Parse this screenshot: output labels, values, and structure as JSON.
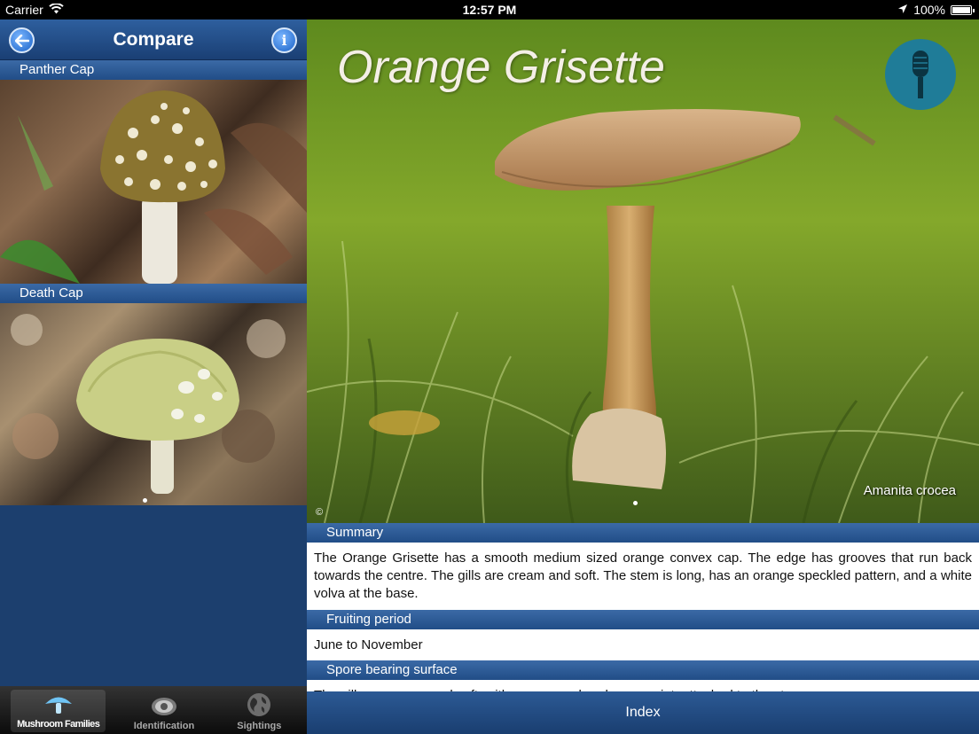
{
  "status": {
    "carrier": "Carrier",
    "time": "12:57 PM",
    "battery": "100%"
  },
  "nav": {
    "title": "Compare"
  },
  "compare": {
    "items": [
      {
        "label": "Panther Cap"
      },
      {
        "label": "Death Cap"
      }
    ]
  },
  "tabs": [
    {
      "label": "Mushroom Families",
      "icon": "mushroom-icon"
    },
    {
      "label": "Identification",
      "icon": "eye-icon"
    },
    {
      "label": "Sightings",
      "icon": "globe-icon"
    }
  ],
  "species": {
    "common_name": "Orange Grisette",
    "latin_name": "Amanita crocea",
    "copyright": "©"
  },
  "sections": {
    "summary_title": "Summary",
    "summary_text": "The Orange Grisette has a smooth medium sized orange convex cap. The edge has grooves that run back towards the centre. The gills are cream and soft. The stem is long, has an orange speckled pattern, and a white volva at the base.",
    "fruiting_title": "Fruiting period",
    "fruiting_text": "June to November",
    "spore_title": "Spore bearing surface",
    "spore_text": "The gills are cream and soft, with a cream colored spore print, attached to the stem."
  },
  "index_label": "Index",
  "colors": {
    "nav_blue": "#1c3f6e",
    "accent_blue": "#1a62c7",
    "mic_teal": "#1f7c98"
  }
}
